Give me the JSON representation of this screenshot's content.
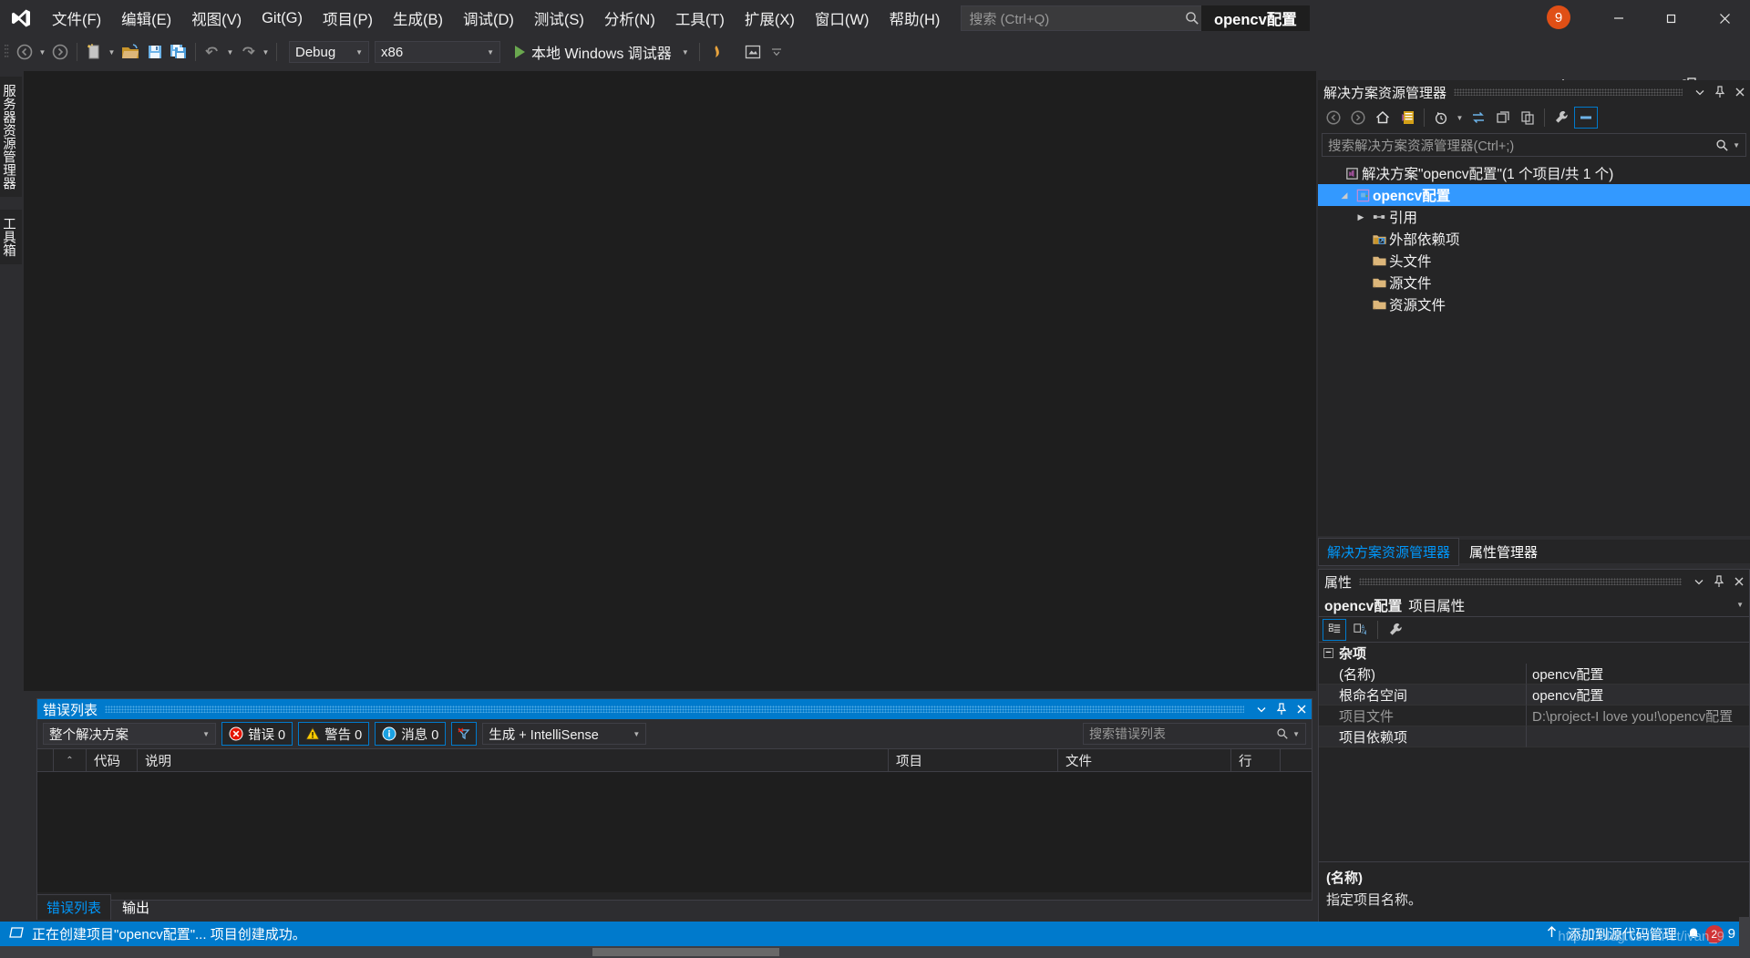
{
  "window": {
    "title": "opencv配置",
    "notification_count": "9",
    "minimize": "−",
    "maximize": "❐",
    "close": "✕"
  },
  "menu": {
    "items": [
      {
        "label": "文件(F)",
        "mnemonic": "F"
      },
      {
        "label": "编辑(E)",
        "mnemonic": "E"
      },
      {
        "label": "视图(V)",
        "mnemonic": "V"
      },
      {
        "label": "Git(G)",
        "mnemonic": "G"
      },
      {
        "label": "项目(P)",
        "mnemonic": "P"
      },
      {
        "label": "生成(B)",
        "mnemonic": "B"
      },
      {
        "label": "调试(D)",
        "mnemonic": "D"
      },
      {
        "label": "测试(S)",
        "mnemonic": "S"
      },
      {
        "label": "分析(N)",
        "mnemonic": "N"
      },
      {
        "label": "工具(T)",
        "mnemonic": "T"
      },
      {
        "label": "扩展(X)",
        "mnemonic": "X"
      },
      {
        "label": "窗口(W)",
        "mnemonic": "W"
      },
      {
        "label": "帮助(H)",
        "mnemonic": "H"
      }
    ]
  },
  "search": {
    "placeholder": "搜索 (Ctrl+Q)",
    "value": ""
  },
  "toolbar": {
    "configuration": "Debug",
    "platform": "x86",
    "run_label": "本地 Windows 调试器",
    "live_share": "Live Share"
  },
  "left_rail": {
    "tabs": [
      "服务器资源管理器",
      "工具箱"
    ]
  },
  "solution_explorer": {
    "title": "解决方案资源管理器",
    "search_placeholder": "搜索解决方案资源管理器(Ctrl+;)",
    "tree": [
      {
        "label": "解决方案\"opencv配置\"(1 个项目/共 1 个)",
        "icon": "solution-icon",
        "indent": 0,
        "twisty": "",
        "selected": false,
        "bold": false
      },
      {
        "label": "opencv配置",
        "icon": "cpp-project-icon",
        "indent": 1,
        "twisty": "▲",
        "selected": true,
        "bold": true
      },
      {
        "label": "引用",
        "icon": "references-icon",
        "indent": 2,
        "twisty": "▶",
        "selected": false,
        "bold": false
      },
      {
        "label": "外部依赖项",
        "icon": "external-deps-folder-icon",
        "indent": 3,
        "twisty": "",
        "selected": false,
        "bold": false
      },
      {
        "label": "头文件",
        "icon": "folder-icon",
        "indent": 3,
        "twisty": "",
        "selected": false,
        "bold": false
      },
      {
        "label": "源文件",
        "icon": "folder-icon",
        "indent": 3,
        "twisty": "",
        "selected": false,
        "bold": false
      },
      {
        "label": "资源文件",
        "icon": "folder-icon",
        "indent": 3,
        "twisty": "",
        "selected": false,
        "bold": false
      }
    ],
    "tabs": [
      {
        "label": "解决方案资源管理器",
        "active": true
      },
      {
        "label": "属性管理器",
        "active": false
      }
    ]
  },
  "properties": {
    "title": "属性",
    "object_name": "opencv配置",
    "object_kind": "项目属性",
    "category": "杂项",
    "rows": [
      {
        "key": "(名称)",
        "value": "opencv配置",
        "dim": false
      },
      {
        "key": "根命名空间",
        "value": "opencv配置",
        "dim": false
      },
      {
        "key": "项目文件",
        "value": "D:\\project-I love you!\\opencv配置",
        "dim": true
      },
      {
        "key": "项目依赖项",
        "value": "",
        "dim": false
      }
    ],
    "description_title": "(名称)",
    "description_text": "指定项目名称。"
  },
  "error_list": {
    "title": "错误列表",
    "scope": "整个解决方案",
    "errors_label": "错误 0",
    "warnings_label": "警告 0",
    "messages_label": "消息 0",
    "build_filter": "生成 + IntelliSense",
    "search_placeholder": "搜索错误列表",
    "columns": [
      "",
      "",
      "代码",
      "说明",
      "项目",
      "文件",
      "行"
    ],
    "rows": [],
    "tabs": [
      {
        "label": "错误列表",
        "active": true
      },
      {
        "label": "输出",
        "active": false
      }
    ]
  },
  "status_bar": {
    "message": "正在创建项目\"opencv配置\"... 项目创建成功。",
    "source_control": "添加到源代码管理",
    "badge_count": "2",
    "right_count": "9",
    "watermark": "https://blog.csdn.net/ivan_9"
  },
  "colors": {
    "accent_blue": "#007acc",
    "selection_blue": "#3399ff",
    "link_blue": "#0097fb",
    "chrome_bg": "#2d2d30",
    "panel_bg": "#252526",
    "editor_bg": "#1e1e1e",
    "badge_orange": "#e04f16",
    "badge_red": "#d13438",
    "folder_yellow": "#dcb67a",
    "run_green": "#6aa84f"
  }
}
